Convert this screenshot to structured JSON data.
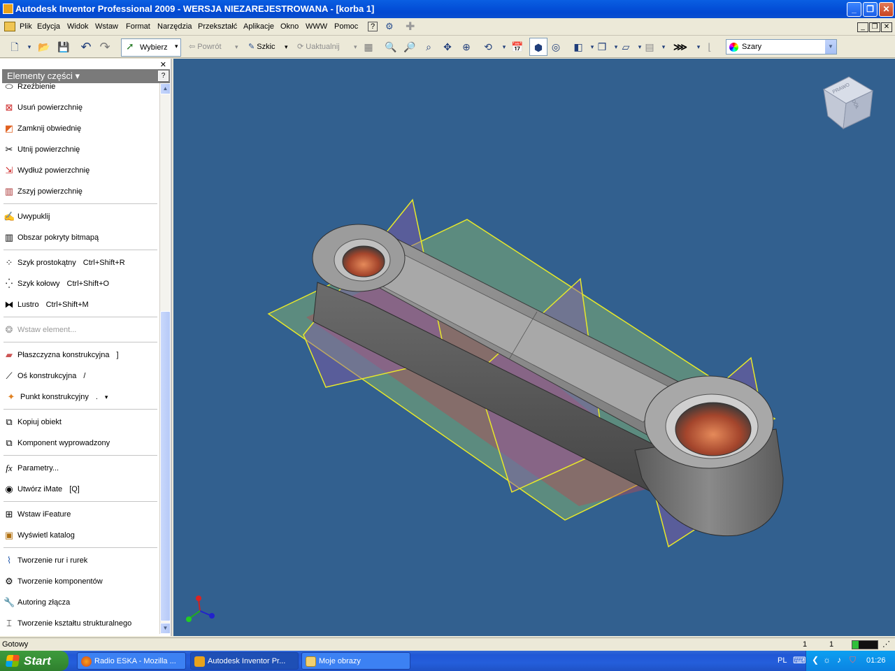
{
  "window": {
    "title": "Autodesk Inventor Professional 2009 - WERSJA NIEZAREJESTROWANA - [korba 1]"
  },
  "menu": [
    "Plik",
    "Edycja",
    "Widok",
    "Wstaw",
    "Format",
    "Narzędzia",
    "Przekształć",
    "Aplikacje",
    "Okno",
    "WWW",
    "Pomoc"
  ],
  "toolbar": {
    "select_label": "Wybierz",
    "back_label": "Powrót",
    "sketch_label": "Szkic",
    "update_label": "Uaktualnij",
    "color_value": "Szary"
  },
  "panel": {
    "title": "Elementy części",
    "items": [
      {
        "label": "Rzeźbienie",
        "icon": "sculpt-icon"
      },
      {
        "label": "Usuń powierzchnię",
        "icon": "delete-face-icon"
      },
      {
        "label": "Zamknij obwiednię",
        "icon": "boundary-patch-icon"
      },
      {
        "label": "Utnij powierzchnię",
        "icon": "trim-surface-icon"
      },
      {
        "label": "Wydłuż powierzchnię",
        "icon": "extend-surface-icon"
      },
      {
        "label": "Zszyj powierzchnię",
        "icon": "stitch-surface-icon"
      },
      {
        "label": "Uwypuklij",
        "icon": "emboss-icon"
      },
      {
        "label": "Obszar pokryty bitmapą",
        "icon": "decal-icon"
      },
      {
        "label": "Szyk prostokątny",
        "shortcut": "Ctrl+Shift+R",
        "icon": "rectangular-pattern-icon"
      },
      {
        "label": "Szyk kołowy",
        "shortcut": "Ctrl+Shift+O",
        "icon": "circular-pattern-icon"
      },
      {
        "label": "Lustro",
        "shortcut": "Ctrl+Shift+M",
        "icon": "mirror-icon"
      },
      {
        "label": "Wstaw element...",
        "icon": "insert-feature-icon"
      },
      {
        "label": "Płaszczyzna konstrukcyjna",
        "shortcut": "]",
        "icon": "work-plane-icon"
      },
      {
        "label": "Oś konstrukcyjna",
        "shortcut": "/",
        "icon": "work-axis-icon"
      },
      {
        "label": "Punkt konstrukcyjny",
        "shortcut": ".",
        "icon": "work-point-icon"
      },
      {
        "label": "Kopiuj obiekt",
        "icon": "copy-object-icon"
      },
      {
        "label": "Komponent wyprowadzony",
        "icon": "derived-component-icon"
      },
      {
        "label": "Parametry...",
        "icon": "parameters-icon"
      },
      {
        "label": "Utwórz iMate",
        "shortcut": "[Q]",
        "icon": "imate-icon"
      },
      {
        "label": "Wstaw iFeature",
        "icon": "ifeature-icon"
      },
      {
        "label": "Wyświetl katalog",
        "icon": "catalog-icon"
      },
      {
        "label": "Tworzenie rur i rurek",
        "icon": "tube-pipe-icon"
      },
      {
        "label": "Tworzenie komponentów",
        "icon": "component-generator-icon"
      },
      {
        "label": "Autoring złącza",
        "icon": "connector-authoring-icon"
      },
      {
        "label": "Tworzenie kształtu strukturalnego",
        "icon": "structural-shape-icon"
      }
    ]
  },
  "viewcube": {
    "face_top": "PRAWO",
    "face_side": "DÓŁ"
  },
  "status": {
    "text": "Gotowy",
    "value1": "1",
    "value2": "1"
  },
  "taskbar": {
    "start": "Start",
    "tasks": [
      {
        "label": "Radio ESKA - Mozilla ...",
        "icon": "firefox-icon"
      },
      {
        "label": "Autodesk Inventor Pr...",
        "icon": "inventor-icon"
      },
      {
        "label": "Moje obrazy",
        "icon": "folder-icon"
      }
    ],
    "lang": "PL",
    "time": "01:26"
  },
  "colors": {
    "viewport_bg": "#32608f",
    "titlebar": "#0450d8",
    "panel_header": "#7a7a7a"
  }
}
